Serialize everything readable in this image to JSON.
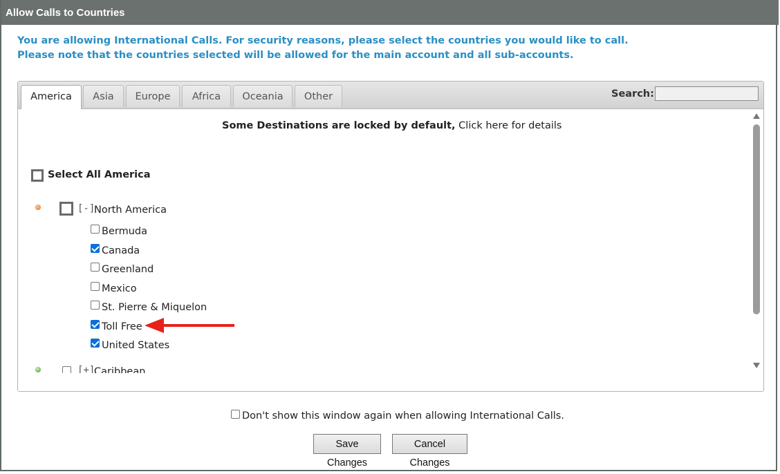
{
  "dialog": {
    "title": "Allow Calls to Countries",
    "notice_line1": "You are allowing International Calls. For security reasons, please select the countries you would like to call.",
    "notice_line2": "Please note that the countries selected will be allowed for the main account and all sub-accounts."
  },
  "tabs": [
    {
      "label": "America",
      "active": true
    },
    {
      "label": "Asia",
      "active": false
    },
    {
      "label": "Europe",
      "active": false
    },
    {
      "label": "Africa",
      "active": false
    },
    {
      "label": "Oceania",
      "active": false
    },
    {
      "label": "Other",
      "active": false
    }
  ],
  "search": {
    "label": "Search:",
    "value": ""
  },
  "locked_notice": {
    "bold": "Some Destinations are locked by default,",
    "link": "Click here for details"
  },
  "select_all": {
    "label": "Select All America",
    "checked": false
  },
  "groups": [
    {
      "bracket": "[-]",
      "label": "North America",
      "expanded": true,
      "countries": [
        {
          "label": "Bermuda",
          "checked": false
        },
        {
          "label": "Canada",
          "checked": true
        },
        {
          "label": "Greenland",
          "checked": false
        },
        {
          "label": "Mexico",
          "checked": false
        },
        {
          "label": "St. Pierre & Miquelon",
          "checked": false
        },
        {
          "label": "Toll Free",
          "checked": true
        },
        {
          "label": "United States",
          "checked": true
        }
      ]
    },
    {
      "bracket": "[+]",
      "label": "Caribbean",
      "expanded": false,
      "countries": []
    }
  ],
  "footer": {
    "dont_show_label": "Don't show this window again when allowing International Calls.",
    "dont_show_checked": false,
    "save_label": "Save Changes",
    "cancel_label": "Cancel Changes"
  },
  "colors": {
    "title_bar": "#6b716e",
    "notice_text": "#2a8fc4",
    "checkbox_checked": "#0a6fdb",
    "annotation_arrow": "#e8201a"
  }
}
